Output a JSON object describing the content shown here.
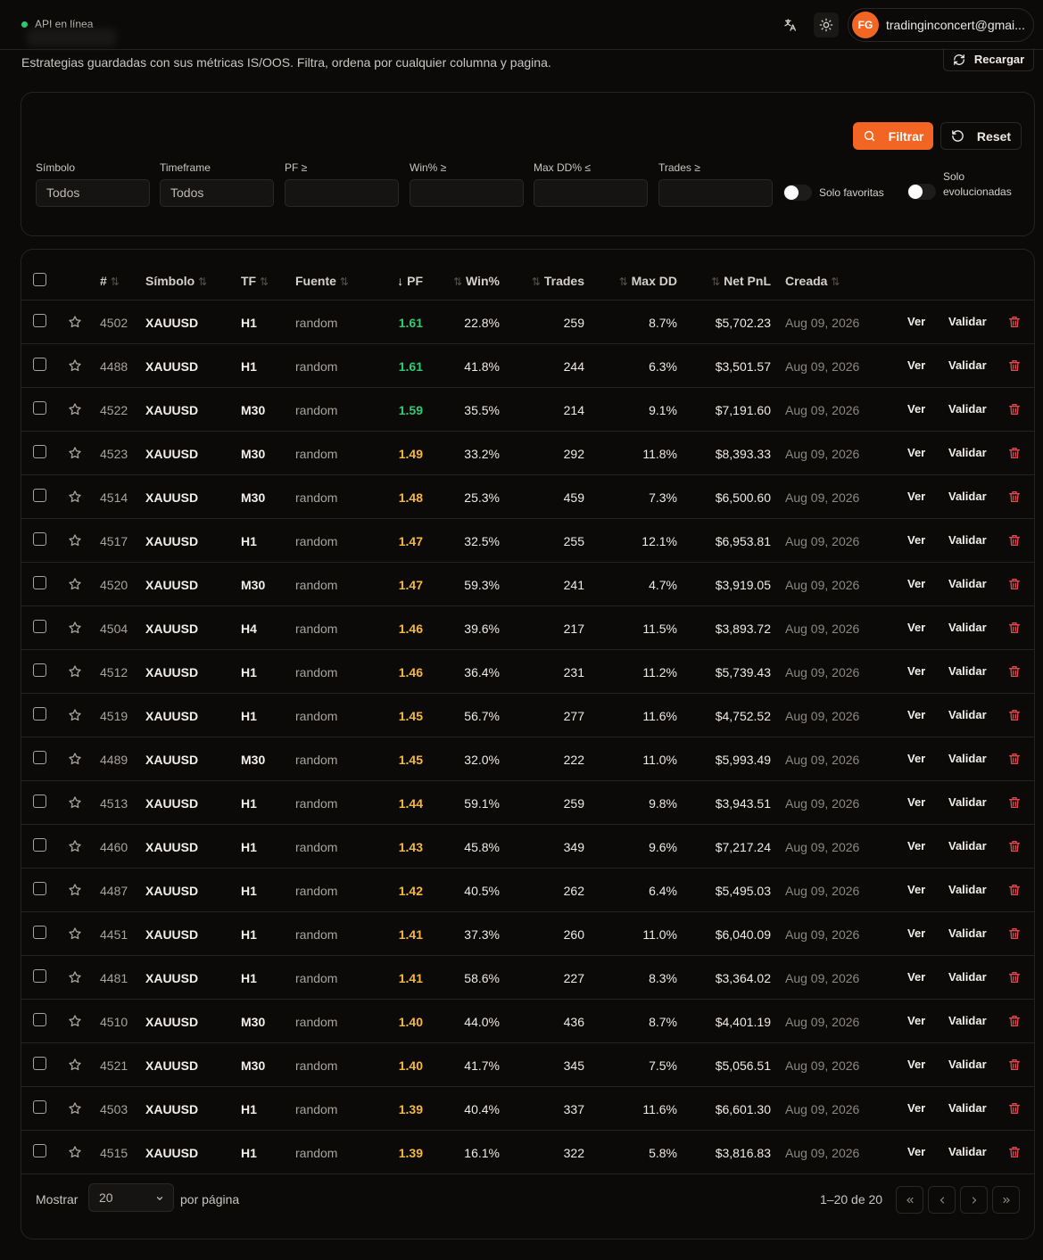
{
  "status": {
    "api_label": "API en línea"
  },
  "user": {
    "initials": "FG",
    "email": "tradinginconcert@gmai..."
  },
  "page": {
    "subtitle": "Estrategias guardadas con sus métricas IS/OOS. Filtra, ordena por cualquier columna y pagina.",
    "reload_label": "Recargar"
  },
  "filters": {
    "filtrar_label": "Filtrar",
    "reset_label": "Reset",
    "symbol": {
      "label": "Símbolo",
      "value": "Todos"
    },
    "timeframe": {
      "label": "Timeframe",
      "value": "Todos"
    },
    "pf": {
      "label": "PF ≥",
      "value": ""
    },
    "win": {
      "label": "Win% ≥",
      "value": ""
    },
    "maxdd": {
      "label": "Max DD% ≤",
      "value": ""
    },
    "trades": {
      "label": "Trades ≥",
      "value": ""
    },
    "solo_favoritas": "Solo favoritas",
    "solo_evolucionadas_1": "Solo",
    "solo_evolucionadas_2": "evolucionadas"
  },
  "table": {
    "headers": {
      "id": "#",
      "symbol": "Símbolo",
      "tf": "TF",
      "source": "Fuente",
      "pf": "PF",
      "win": "Win%",
      "trades": "Trades",
      "maxdd": "Max DD",
      "netpnl": "Net PnL",
      "created": "Creada"
    },
    "action_view": "Ver",
    "action_validate": "Validar",
    "rows": [
      {
        "id": "4502",
        "symbol": "XAUUSD",
        "tf": "H1",
        "source": "random",
        "pf": "1.61",
        "win": "22.8%",
        "trades": "259",
        "maxdd": "8.7%",
        "netpnl": "$5,702.23",
        "created": "Aug 09, 2026",
        "tier": "good"
      },
      {
        "id": "4488",
        "symbol": "XAUUSD",
        "tf": "H1",
        "source": "random",
        "pf": "1.61",
        "win": "41.8%",
        "trades": "244",
        "maxdd": "6.3%",
        "netpnl": "$3,501.57",
        "created": "Aug 09, 2026",
        "tier": "good"
      },
      {
        "id": "4522",
        "symbol": "XAUUSD",
        "tf": "M30",
        "source": "random",
        "pf": "1.59",
        "win": "35.5%",
        "trades": "214",
        "maxdd": "9.1%",
        "netpnl": "$7,191.60",
        "created": "Aug 09, 2026",
        "tier": "good"
      },
      {
        "id": "4523",
        "symbol": "XAUUSD",
        "tf": "M30",
        "source": "random",
        "pf": "1.49",
        "win": "33.2%",
        "trades": "292",
        "maxdd": "11.8%",
        "netpnl": "$8,393.33",
        "created": "Aug 09, 2026",
        "tier": "mid"
      },
      {
        "id": "4514",
        "symbol": "XAUUSD",
        "tf": "M30",
        "source": "random",
        "pf": "1.48",
        "win": "25.3%",
        "trades": "459",
        "maxdd": "7.3%",
        "netpnl": "$6,500.60",
        "created": "Aug 09, 2026",
        "tier": "mid"
      },
      {
        "id": "4517",
        "symbol": "XAUUSD",
        "tf": "H1",
        "source": "random",
        "pf": "1.47",
        "win": "32.5%",
        "trades": "255",
        "maxdd": "12.1%",
        "netpnl": "$6,953.81",
        "created": "Aug 09, 2026",
        "tier": "mid"
      },
      {
        "id": "4520",
        "symbol": "XAUUSD",
        "tf": "M30",
        "source": "random",
        "pf": "1.47",
        "win": "59.3%",
        "trades": "241",
        "maxdd": "4.7%",
        "netpnl": "$3,919.05",
        "created": "Aug 09, 2026",
        "tier": "mid"
      },
      {
        "id": "4504",
        "symbol": "XAUUSD",
        "tf": "H4",
        "source": "random",
        "pf": "1.46",
        "win": "39.6%",
        "trades": "217",
        "maxdd": "11.5%",
        "netpnl": "$3,893.72",
        "created": "Aug 09, 2026",
        "tier": "mid"
      },
      {
        "id": "4512",
        "symbol": "XAUUSD",
        "tf": "H1",
        "source": "random",
        "pf": "1.46",
        "win": "36.4%",
        "trades": "231",
        "maxdd": "11.2%",
        "netpnl": "$5,739.43",
        "created": "Aug 09, 2026",
        "tier": "mid"
      },
      {
        "id": "4519",
        "symbol": "XAUUSD",
        "tf": "H1",
        "source": "random",
        "pf": "1.45",
        "win": "56.7%",
        "trades": "277",
        "maxdd": "11.6%",
        "netpnl": "$4,752.52",
        "created": "Aug 09, 2026",
        "tier": "mid"
      },
      {
        "id": "4489",
        "symbol": "XAUUSD",
        "tf": "M30",
        "source": "random",
        "pf": "1.45",
        "win": "32.0%",
        "trades": "222",
        "maxdd": "11.0%",
        "netpnl": "$5,993.49",
        "created": "Aug 09, 2026",
        "tier": "mid"
      },
      {
        "id": "4513",
        "symbol": "XAUUSD",
        "tf": "H1",
        "source": "random",
        "pf": "1.44",
        "win": "59.1%",
        "trades": "259",
        "maxdd": "9.8%",
        "netpnl": "$3,943.51",
        "created": "Aug 09, 2026",
        "tier": "mid"
      },
      {
        "id": "4460",
        "symbol": "XAUUSD",
        "tf": "H1",
        "source": "random",
        "pf": "1.43",
        "win": "45.8%",
        "trades": "349",
        "maxdd": "9.6%",
        "netpnl": "$7,217.24",
        "created": "Aug 09, 2026",
        "tier": "mid"
      },
      {
        "id": "4487",
        "symbol": "XAUUSD",
        "tf": "H1",
        "source": "random",
        "pf": "1.42",
        "win": "40.5%",
        "trades": "262",
        "maxdd": "6.4%",
        "netpnl": "$5,495.03",
        "created": "Aug 09, 2026",
        "tier": "mid"
      },
      {
        "id": "4451",
        "symbol": "XAUUSD",
        "tf": "H1",
        "source": "random",
        "pf": "1.41",
        "win": "37.3%",
        "trades": "260",
        "maxdd": "11.0%",
        "netpnl": "$6,040.09",
        "created": "Aug 09, 2026",
        "tier": "mid"
      },
      {
        "id": "4481",
        "symbol": "XAUUSD",
        "tf": "H1",
        "source": "random",
        "pf": "1.41",
        "win": "58.6%",
        "trades": "227",
        "maxdd": "8.3%",
        "netpnl": "$3,364.02",
        "created": "Aug 09, 2026",
        "tier": "mid"
      },
      {
        "id": "4510",
        "symbol": "XAUUSD",
        "tf": "M30",
        "source": "random",
        "pf": "1.40",
        "win": "44.0%",
        "trades": "436",
        "maxdd": "8.7%",
        "netpnl": "$4,401.19",
        "created": "Aug 09, 2026",
        "tier": "mid"
      },
      {
        "id": "4521",
        "symbol": "XAUUSD",
        "tf": "M30",
        "source": "random",
        "pf": "1.40",
        "win": "41.7%",
        "trades": "345",
        "maxdd": "7.5%",
        "netpnl": "$5,056.51",
        "created": "Aug 09, 2026",
        "tier": "mid"
      },
      {
        "id": "4503",
        "symbol": "XAUUSD",
        "tf": "H1",
        "source": "random",
        "pf": "1.39",
        "win": "40.4%",
        "trades": "337",
        "maxdd": "11.6%",
        "netpnl": "$6,601.30",
        "created": "Aug 09, 2026",
        "tier": "mid"
      },
      {
        "id": "4515",
        "symbol": "XAUUSD",
        "tf": "H1",
        "source": "random",
        "pf": "1.39",
        "win": "16.1%",
        "trades": "322",
        "maxdd": "5.8%",
        "netpnl": "$3,816.83",
        "created": "Aug 09, 2026",
        "tier": "mid"
      }
    ]
  },
  "pagination": {
    "show_label": "Mostrar",
    "per_page_value": "20",
    "per_page_label": "por página",
    "range_label": "1–20 de 20"
  },
  "colors": {
    "accent": "#f26522",
    "pf_good": "#2ecc71",
    "pf_mid": "#f5b83d",
    "danger": "#e5484d",
    "online": "#2ecc71"
  }
}
